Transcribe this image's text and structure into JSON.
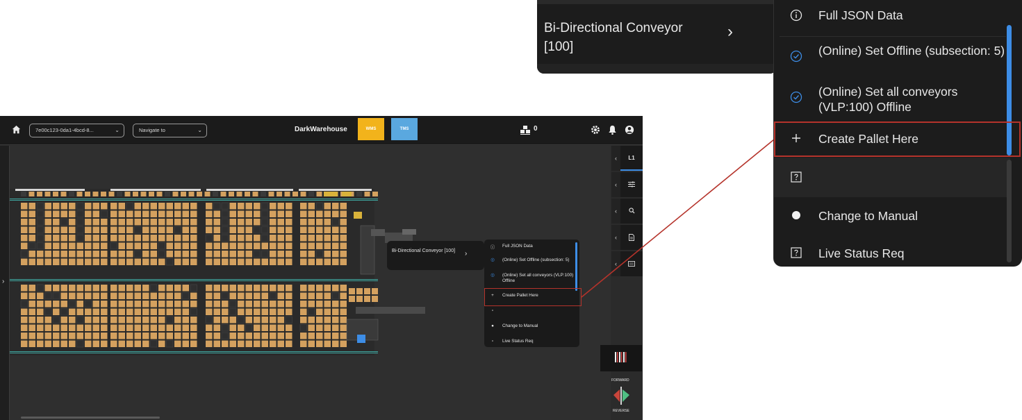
{
  "topbar": {
    "warehouse_id": "7e00c123-0da1-4bcd-8...",
    "navigate_placeholder": "Navigate to",
    "brand": "DarkWarehouse",
    "wms_label": "WMS",
    "tms_label": "TMS",
    "pallet_count": "0",
    "colors": {
      "wms": "#f2b31b",
      "tms": "#5aa8df"
    }
  },
  "side_panel": {
    "level_label": "L1"
  },
  "direction": {
    "forward": "FORWARD",
    "reverse": "REVERSE"
  },
  "context": {
    "submenu_title": "Bi-Directional Conveyor [100]",
    "items": [
      {
        "icon": "info-icon",
        "label": "Full JSON Data"
      },
      {
        "icon": "check-circle-icon",
        "label": "(Online) Set Offline (subsection: 5)"
      },
      {
        "icon": "check-circle-icon",
        "label": "(Online) Set all conveyors (VLP:100) Offline"
      },
      {
        "icon": "plus-icon",
        "label": "Create Pallet Here"
      },
      {
        "icon": "question-box-icon",
        "label": ""
      },
      {
        "icon": "dot-icon",
        "label": "Change to Manual"
      },
      {
        "icon": "question-box-icon",
        "label": "Live Status Req"
      }
    ],
    "highlight_color": "#b5332b",
    "scroll_color": "#3d8de6"
  }
}
